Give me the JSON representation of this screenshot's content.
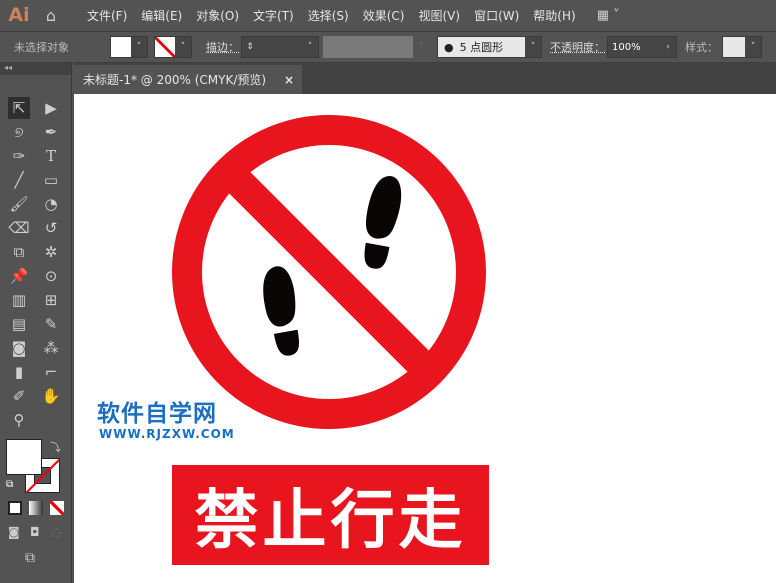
{
  "app": {
    "logo": "Ai"
  },
  "menu": [
    "文件(F)",
    "编辑(E)",
    "对象(O)",
    "文字(T)",
    "选择(S)",
    "效果(C)",
    "视图(V)",
    "窗口(W)",
    "帮助(H)"
  ],
  "control": {
    "selection": "未选择对象",
    "stroke_label": "描边：",
    "brush": "5 点圆形",
    "opacity_label": "不透明度：",
    "opacity": "100%",
    "style_label": "样式："
  },
  "tab": {
    "title": "未标题-1* @ 200% (CMYK/预览)",
    "close": "×"
  },
  "artwork": {
    "watermark_cn": "软件自学网",
    "watermark_url": "WWW.RJZXW.COM",
    "sign_text": "禁止行走",
    "red": "#e8141e",
    "blue": "#1a6fc4"
  }
}
